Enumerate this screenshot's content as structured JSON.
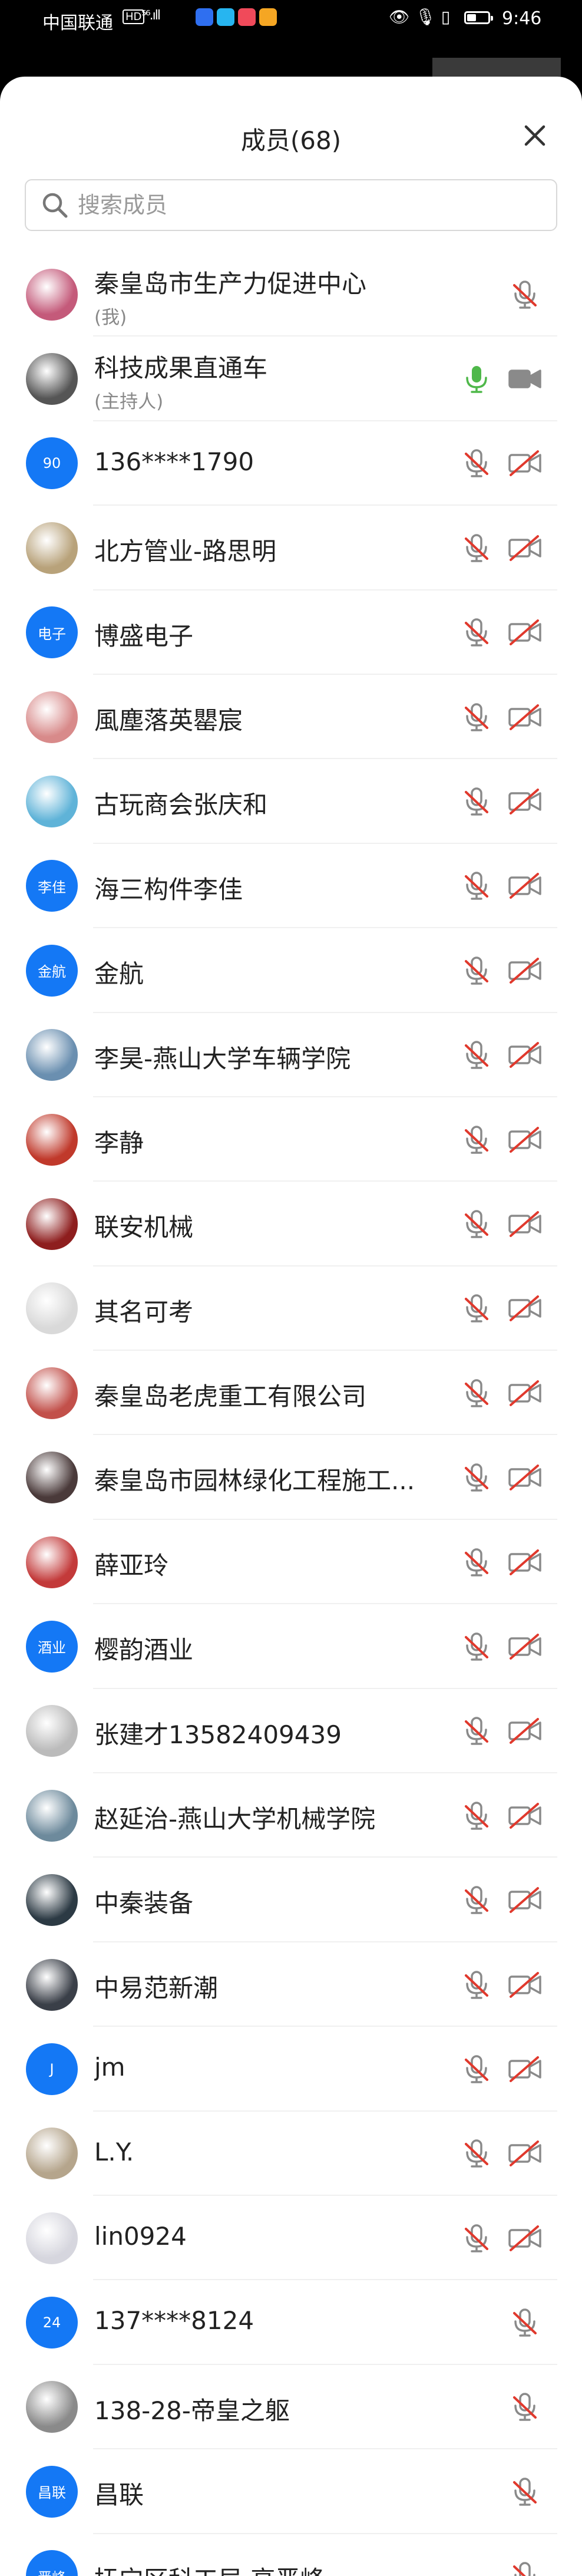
{
  "status_bar": {
    "carrier": "中国联通",
    "network_badge": "HD",
    "signal": "⁵⁶.ıll",
    "time": "9:46",
    "battery_level": 0.45,
    "icons": [
      "eye-icon",
      "mic-icon",
      "vibrate-icon",
      "battery-icon"
    ],
    "app_icons": [
      {
        "name": "app-icon-blue",
        "color": "#2f6ff0"
      },
      {
        "name": "app-icon-cyan",
        "color": "#27b5f0"
      },
      {
        "name": "app-icon-red",
        "color": "#f04a5a"
      },
      {
        "name": "app-icon-yellow",
        "color": "#f5a623"
      }
    ]
  },
  "sheet": {
    "title": "成员(68)",
    "search_placeholder": "搜索成员",
    "search_value": ""
  },
  "colors": {
    "mic_on": "#4fb84a",
    "muted_red": "#e0392d",
    "icon_gray": "#8a8a8a",
    "initials_bg": "#1478f5"
  },
  "members": [
    {
      "name": "秦皇岛市生产力促进中心",
      "sub": "(我)",
      "avatar_type": "image",
      "avatar_color": "#c45a7a",
      "mic": "muted",
      "camera": null
    },
    {
      "name": "科技成果直通车",
      "sub": "(主持人)",
      "avatar_type": "image",
      "avatar_color": "#555",
      "mic": "on",
      "camera": "on"
    },
    {
      "name": "136****1790",
      "sub": "",
      "avatar_type": "initials",
      "initials": "90",
      "mic": "muted",
      "camera": "off"
    },
    {
      "name": "北方管业-路思明",
      "sub": "",
      "avatar_type": "image",
      "avatar_color": "#b8a27a",
      "mic": "muted",
      "camera": "off"
    },
    {
      "name": "博盛电子",
      "sub": "",
      "avatar_type": "initials",
      "initials": "电子",
      "mic": "muted",
      "camera": "off"
    },
    {
      "name": "風塵落英罌宸",
      "sub": "",
      "avatar_type": "image",
      "avatar_color": "#d88a8a",
      "mic": "muted",
      "camera": "off"
    },
    {
      "name": "古玩商会张庆和",
      "sub": "",
      "avatar_type": "image",
      "avatar_color": "#5fb3d8",
      "mic": "muted",
      "camera": "off"
    },
    {
      "name": "海三构件李佳",
      "sub": "",
      "avatar_type": "initials",
      "initials": "李佳",
      "mic": "muted",
      "camera": "off"
    },
    {
      "name": "金航",
      "sub": "",
      "avatar_type": "initials",
      "initials": "金航",
      "mic": "muted",
      "camera": "off"
    },
    {
      "name": "李昊-燕山大学车辆学院",
      "sub": "",
      "avatar_type": "image",
      "avatar_color": "#6a8fb0",
      "mic": "muted",
      "camera": "off"
    },
    {
      "name": "李静",
      "sub": "",
      "avatar_type": "image",
      "avatar_color": "#c0392b",
      "mic": "muted",
      "camera": "off"
    },
    {
      "name": "联安机械",
      "sub": "",
      "avatar_type": "image",
      "avatar_color": "#8e1e1e",
      "mic": "muted",
      "camera": "off"
    },
    {
      "name": "其名可考",
      "sub": "",
      "avatar_type": "image",
      "avatar_color": "#d9d9d9",
      "mic": "muted",
      "camera": "off"
    },
    {
      "name": "秦皇岛老虎重工有限公司",
      "sub": "",
      "avatar_type": "image",
      "avatar_color": "#c2504a",
      "mic": "muted",
      "camera": "off"
    },
    {
      "name": "秦皇岛市园林绿化工程施工...",
      "sub": "",
      "avatar_type": "image",
      "avatar_color": "#4a3a3a",
      "mic": "muted",
      "camera": "off"
    },
    {
      "name": "薛亚玲",
      "sub": "",
      "avatar_type": "image",
      "avatar_color": "#c33a3a",
      "mic": "muted",
      "camera": "off"
    },
    {
      "name": "樱韵酒业",
      "sub": "",
      "avatar_type": "initials",
      "initials": "酒业",
      "mic": "muted",
      "camera": "off"
    },
    {
      "name": "张建才13582409439",
      "sub": "",
      "avatar_type": "image",
      "avatar_color": "#bbbbbb",
      "mic": "muted",
      "camera": "off"
    },
    {
      "name": "赵延治-燕山大学机械学院",
      "sub": "",
      "avatar_type": "image",
      "avatar_color": "#6d8a9c",
      "mic": "muted",
      "camera": "off"
    },
    {
      "name": "中秦装备",
      "sub": "",
      "avatar_type": "image",
      "avatar_color": "#2c3a44",
      "mic": "muted",
      "camera": "off"
    },
    {
      "name": "中易范新潮",
      "sub": "",
      "avatar_type": "image",
      "avatar_color": "#3a3f48",
      "mic": "muted",
      "camera": "off"
    },
    {
      "name": "jm",
      "sub": "",
      "avatar_type": "initials",
      "initials": "J",
      "mic": "muted",
      "camera": "off"
    },
    {
      "name": "L.Y.",
      "sub": "",
      "avatar_type": "image",
      "avatar_color": "#b5a58c",
      "mic": "muted",
      "camera": "off"
    },
    {
      "name": "lin0924",
      "sub": "",
      "avatar_type": "image",
      "avatar_color": "#d6d6de",
      "mic": "muted",
      "camera": "off"
    },
    {
      "name": "137****8124",
      "sub": "",
      "avatar_type": "initials",
      "initials": "24",
      "mic": "muted",
      "camera": null
    },
    {
      "name": "138-28-帝皇之躯",
      "sub": "",
      "avatar_type": "image",
      "avatar_color": "#8a8a8a",
      "mic": "muted",
      "camera": null
    },
    {
      "name": "昌联",
      "sub": "",
      "avatar_type": "initials",
      "initials": "昌联",
      "mic": "muted",
      "camera": null
    },
    {
      "name": "抚宁区科工局 高晋峰",
      "sub": "",
      "avatar_type": "initials",
      "initials": "晋峰",
      "mic": "muted",
      "camera": null
    }
  ]
}
